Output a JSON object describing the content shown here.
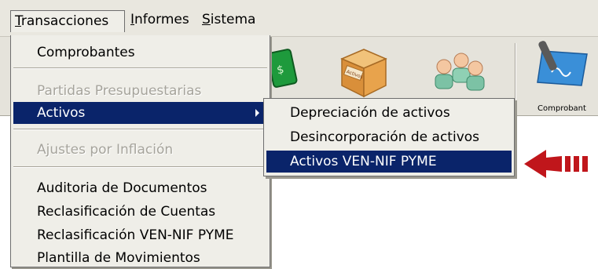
{
  "menubar": {
    "items": [
      {
        "accel": "T",
        "rest": "ransacciones"
      },
      {
        "accel": "I",
        "rest": "nformes"
      },
      {
        "accel": "S",
        "rest": "istema"
      }
    ]
  },
  "toolbar": {
    "comprobantes_label": "Comprobant",
    "box_icon_text": "Activos"
  },
  "menu": {
    "items": [
      {
        "label": "Comprobantes",
        "state": "enabled"
      },
      {
        "label": "Partidas Presupuestarias",
        "state": "disabled"
      },
      {
        "label": "Activos",
        "state": "selected"
      },
      {
        "label": "Ajustes por Inflación",
        "state": "disabled"
      },
      {
        "label": "Auditoria de Documentos",
        "state": "enabled"
      },
      {
        "label": "Reclasificación de Cuentas",
        "state": "enabled"
      },
      {
        "label": "Reclasificación VEN-NIF PYME",
        "state": "enabled"
      },
      {
        "label": "Plantilla de Movimientos",
        "state": "enabled"
      }
    ]
  },
  "submenu": {
    "items": [
      {
        "label": "Depreciación de activos",
        "state": "enabled"
      },
      {
        "label": "Desincorporación de activos",
        "state": "enabled"
      },
      {
        "label": "Activos VEN-NIF PYME",
        "state": "selected"
      }
    ]
  },
  "colors": {
    "selection": "#0a246a",
    "menu_bg": "#efeee8",
    "disabled_text": "#a6a49c",
    "arrow": "#c0161b"
  }
}
